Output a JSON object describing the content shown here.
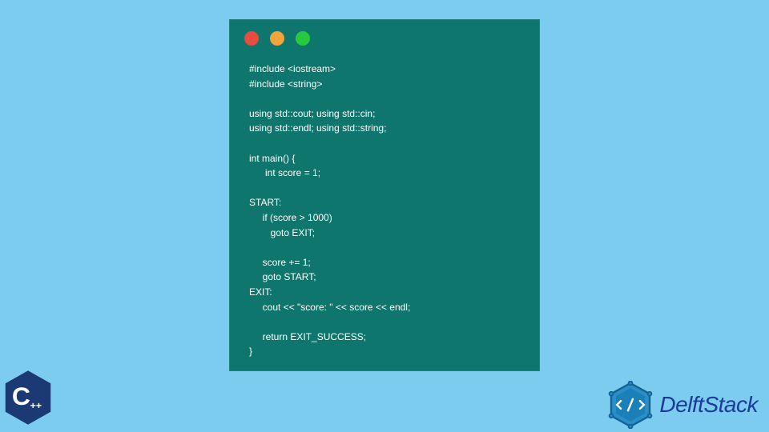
{
  "code": {
    "lines": [
      "#include <iostream>",
      "#include <string>",
      "",
      "using std::cout; using std::cin;",
      "using std::endl; using std::string;",
      "",
      "int main() {",
      "      int score = 1;",
      "",
      "START:",
      "     if (score > 1000)",
      "        goto EXIT;",
      "",
      "     score += 1;",
      "     goto START;",
      "EXIT:",
      "     cout << \"score: \" << score << endl;",
      "",
      "     return EXIT_SUCCESS;",
      "}"
    ]
  },
  "window": {
    "dots": [
      "red",
      "yellow",
      "green"
    ]
  },
  "cpp_logo": {
    "letter": "C",
    "plus": "++"
  },
  "brand": {
    "name": "DelftStack"
  },
  "colors": {
    "background": "#7bccee",
    "window": "#0f766e",
    "dot_red": "#e74c3c",
    "dot_yellow": "#f1a33c",
    "dot_green": "#27c93f",
    "brand_text": "#1b3a9a",
    "cpp_hex": "#1b3a74"
  }
}
